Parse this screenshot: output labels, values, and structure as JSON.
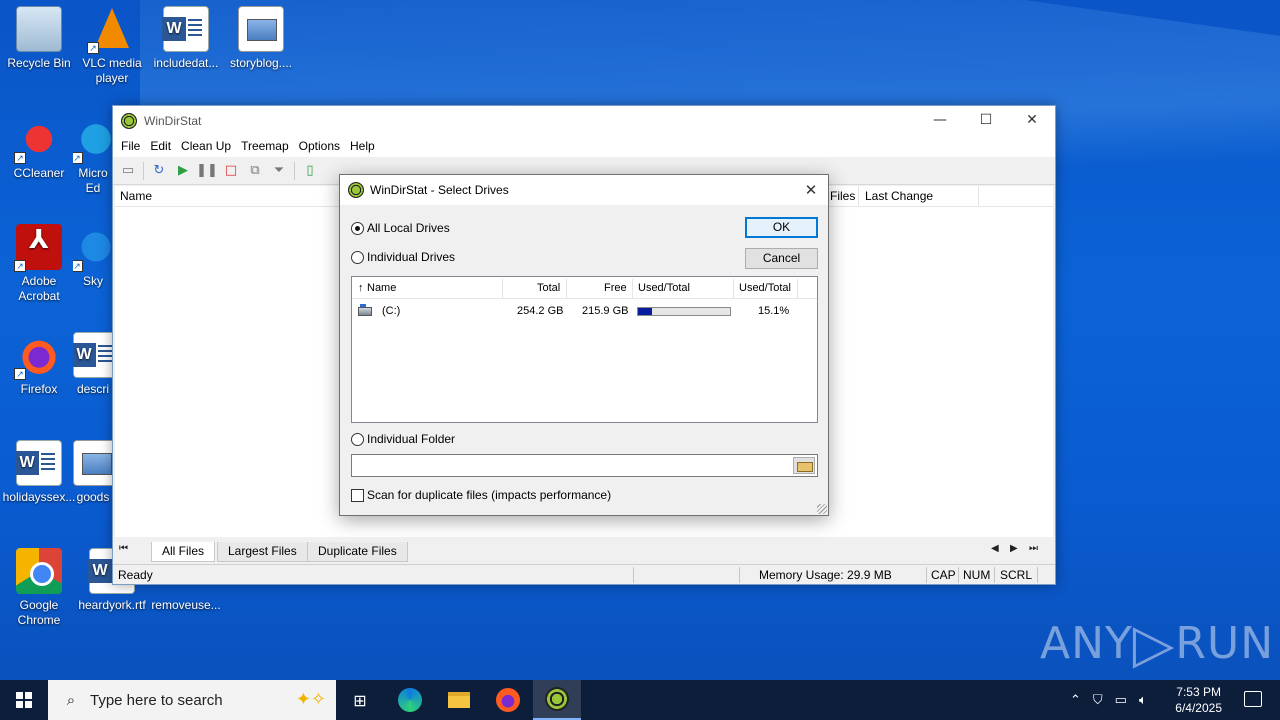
{
  "desktop": {
    "icons": [
      {
        "label": "Recycle Bin"
      },
      {
        "label": "VLC media player"
      },
      {
        "label": "includedat..."
      },
      {
        "label": "storyblog...."
      },
      {
        "label": "CCleaner"
      },
      {
        "label": "Micro Ed"
      },
      {
        "label": "Adobe Acrobat"
      },
      {
        "label": "Sky"
      },
      {
        "label": "Firefox"
      },
      {
        "label": "descri"
      },
      {
        "label": "holidayssex..."
      },
      {
        "label": "goods"
      },
      {
        "label": "Google Chrome"
      },
      {
        "label": "heardyork.rtf"
      },
      {
        "label": "removeuse..."
      }
    ],
    "watermark": {
      "left": "ANY",
      "right": "RUN"
    }
  },
  "main_window": {
    "title": "WinDirStat",
    "controls": {
      "minimize": "—",
      "maximize": "☐",
      "close": "✕"
    },
    "menu": [
      "File",
      "Edit",
      "Clean Up",
      "Treemap",
      "Options",
      "Help"
    ],
    "list_headers": {
      "name": "Name",
      "files": "Files",
      "last_change": "Last Change"
    },
    "tabs": [
      "All Files",
      "Largest Files",
      "Duplicate Files"
    ],
    "status": {
      "ready": "Ready",
      "memory": "Memory Usage: 29.9 MB",
      "cap": "CAP",
      "num": "NUM",
      "scrl": "SCRL"
    }
  },
  "dialog": {
    "title": "WinDirStat - Select Drives",
    "close": "✕",
    "options": {
      "all_local": "All Local Drives",
      "individual_drives": "Individual Drives",
      "individual_folder": "Individual Folder"
    },
    "selected_option": "all_local",
    "buttons": {
      "ok": "OK",
      "cancel": "Cancel"
    },
    "drive_table": {
      "columns": {
        "name": "Name",
        "total": "Total",
        "free": "Free",
        "used_total_bar": "Used/Total",
        "used_total_pct": "Used/Total"
      },
      "sort_indicator": "↑",
      "rows": [
        {
          "name": "(C:)",
          "total": "254.2 GB",
          "free": "215.9 GB",
          "used_fraction": 0.151,
          "used_pct": "15.1%"
        }
      ]
    },
    "folder_path": "",
    "duplicate_checkbox": {
      "label": "Scan for duplicate files (impacts performance)",
      "checked": false
    }
  },
  "taskbar": {
    "search_placeholder": "Type here to search",
    "clock_time": "7:53 PM",
    "clock_date": "6/4/2025"
  },
  "colors": {
    "usage_fill": "#0a1c9e",
    "default_button_border": "#0078d7",
    "taskbar": "#0c1e3a"
  }
}
